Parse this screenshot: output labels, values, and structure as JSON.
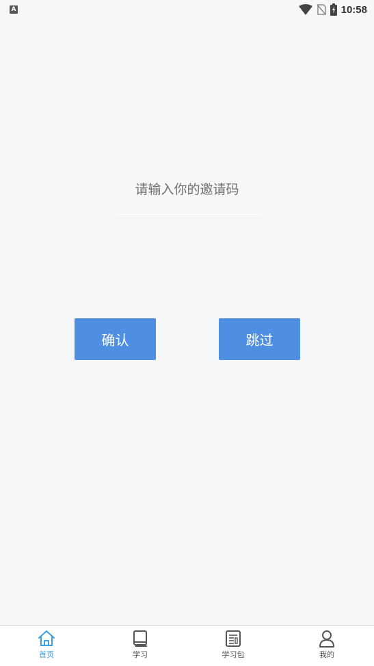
{
  "status_bar": {
    "time": "10:58",
    "left_icon": "A"
  },
  "invite": {
    "prompt": "请输入你的邀请码",
    "input_value": "",
    "input_placeholder": ""
  },
  "actions": {
    "confirm_label": "确认",
    "skip_label": "跳过"
  },
  "colors": {
    "primary_button": "#4f8fe2",
    "tab_active": "#3aa0e8",
    "tab_inactive": "#555555",
    "background": "#f6f7f9"
  },
  "tabbar": {
    "items": [
      {
        "label": "首页",
        "icon": "home-icon",
        "active": true
      },
      {
        "label": "学习",
        "icon": "book-icon",
        "active": false
      },
      {
        "label": "学习包",
        "icon": "document-icon",
        "active": false
      },
      {
        "label": "我的",
        "icon": "person-icon",
        "active": false
      }
    ]
  }
}
